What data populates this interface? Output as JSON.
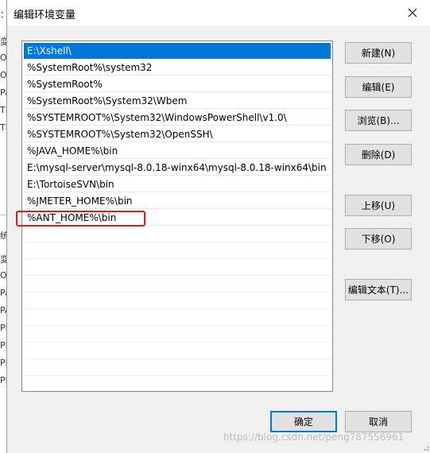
{
  "dialog": {
    "title": "编辑环境变量",
    "close_icon": "close-icon"
  },
  "path_list": [
    "E:\\Xshell\\",
    "%SystemRoot%\\system32",
    "%SystemRoot%",
    "%SystemRoot%\\System32\\Wbem",
    "%SYSTEMROOT%\\System32\\WindowsPowerShell\\v1.0\\",
    "%SYSTEMROOT%\\System32\\OpenSSH\\",
    "%JAVA_HOME%\\bin",
    "E:\\mysql-server\\mysql-8.0.18-winx64\\mysql-8.0.18-winx64\\bin",
    "E:\\TortoiseSVN\\bin",
    "%JMETER_HOME%\\bin",
    "%ANT_HOME%\\bin"
  ],
  "selected_index": 0,
  "highlighted_index": 10,
  "buttons": {
    "new": "新建(N)",
    "edit": "编辑(E)",
    "browse": "浏览(B)...",
    "delete": "删除(D)",
    "move_up": "上移(U)",
    "move_down": "下移(O)",
    "edit_text": "编辑文本(T)...",
    "ok": "确定",
    "cancel": "取消"
  },
  "watermark": "https://blog.csdn.net/peng787556961",
  "colors": {
    "selection": "#0078d7",
    "highlight_box": "#e01b1b",
    "default_button_border": "#0078d7"
  }
}
